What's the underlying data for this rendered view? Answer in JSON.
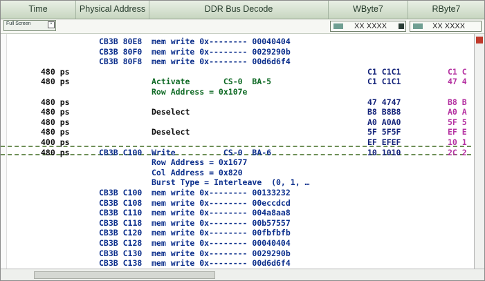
{
  "columns": [
    {
      "label": "Time"
    },
    {
      "label": "Physical Address"
    },
    {
      "label": "DDR Bus Decode"
    },
    {
      "label": "WByte7"
    },
    {
      "label": "RByte7"
    }
  ],
  "full_screen_button": {
    "label": "Full Screen"
  },
  "wbyte_value": "XX XXXX",
  "rbyte_value": "XX XXXX",
  "rows": [
    {
      "time": "",
      "addr": "CB3B 80E8",
      "decode": "mem write 0x-------- 00040404",
      "w": "",
      "r": ""
    },
    {
      "time": "",
      "addr": "CB3B 80F0",
      "decode": "mem write 0x-------- 0029290b",
      "w": "",
      "r": ""
    },
    {
      "time": "",
      "addr": "CB3B 80F8",
      "decode": "mem write 0x-------- 00d6d6f4",
      "w": "",
      "r": ""
    },
    {
      "time": "480 ps",
      "addr": "",
      "decode": "",
      "w": "C1 C1C1",
      "r": "C1 C"
    },
    {
      "time": "480 ps",
      "addr": "",
      "decode": "Activate       CS-0  BA-5",
      "w": "C1 C1C1",
      "r": "47 4"
    },
    {
      "time": "",
      "addr": "",
      "decode": "Row Address = 0x107e",
      "w": "",
      "r": ""
    },
    {
      "time": "480 ps",
      "addr": "",
      "decode": "",
      "w": "47 4747",
      "r": "B8 B"
    },
    {
      "time": "480 ps",
      "addr": "",
      "decode": "Deselect",
      "w": "B8 B8B8",
      "r": "A0 A"
    },
    {
      "time": "480 ps",
      "addr": "",
      "decode": "",
      "w": "A0 A0A0",
      "r": "5F 5"
    },
    {
      "time": "480 ps",
      "addr": "",
      "decode": "Deselect",
      "w": "5F 5F5F",
      "r": "EF E"
    },
    {
      "time": "400 ps",
      "addr": "",
      "decode": "",
      "w": "EF EFEF",
      "r": "10 1"
    },
    {
      "time": "480 ps",
      "addr": "CB3B C100",
      "decode": "Write          CS-0  BA-6",
      "w": "10 1010",
      "r": "2C 2"
    },
    {
      "time": "",
      "addr": "",
      "decode": "Row Address = 0x1677",
      "w": "",
      "r": ""
    },
    {
      "time": "",
      "addr": "",
      "decode": "Col Address = 0x820",
      "w": "",
      "r": ""
    },
    {
      "time": "",
      "addr": "",
      "decode": "Burst Type = Interleave  (0, 1, …",
      "w": "",
      "r": ""
    },
    {
      "time": "",
      "addr": "CB3B C100",
      "decode": "mem write 0x-------- 00133232",
      "w": "",
      "r": ""
    },
    {
      "time": "",
      "addr": "CB3B C108",
      "decode": "mem write 0x-------- 00eccdcd",
      "w": "",
      "r": ""
    },
    {
      "time": "",
      "addr": "CB3B C110",
      "decode": "mem write 0x-------- 004a8aa8",
      "w": "",
      "r": ""
    },
    {
      "time": "",
      "addr": "CB3B C118",
      "decode": "mem write 0x-------- 00b57557",
      "w": "",
      "r": ""
    },
    {
      "time": "",
      "addr": "CB3B C120",
      "decode": "mem write 0x-------- 00fbfbfb",
      "w": "",
      "r": ""
    },
    {
      "time": "",
      "addr": "CB3B C128",
      "decode": "mem write 0x-------- 00040404",
      "w": "",
      "r": ""
    },
    {
      "time": "",
      "addr": "CB3B C130",
      "decode": "mem write 0x-------- 0029290b",
      "w": "",
      "r": ""
    },
    {
      "time": "",
      "addr": "CB3B C138",
      "decode": "mem write 0x-------- 00d6d6f4",
      "w": "",
      "r": ""
    }
  ],
  "colors": {
    "address": "#0c2f8c",
    "command": "#111111",
    "decode_detail": "#0f6a25",
    "wbyte": "#14237a",
    "rbyte": "#b531a1"
  }
}
